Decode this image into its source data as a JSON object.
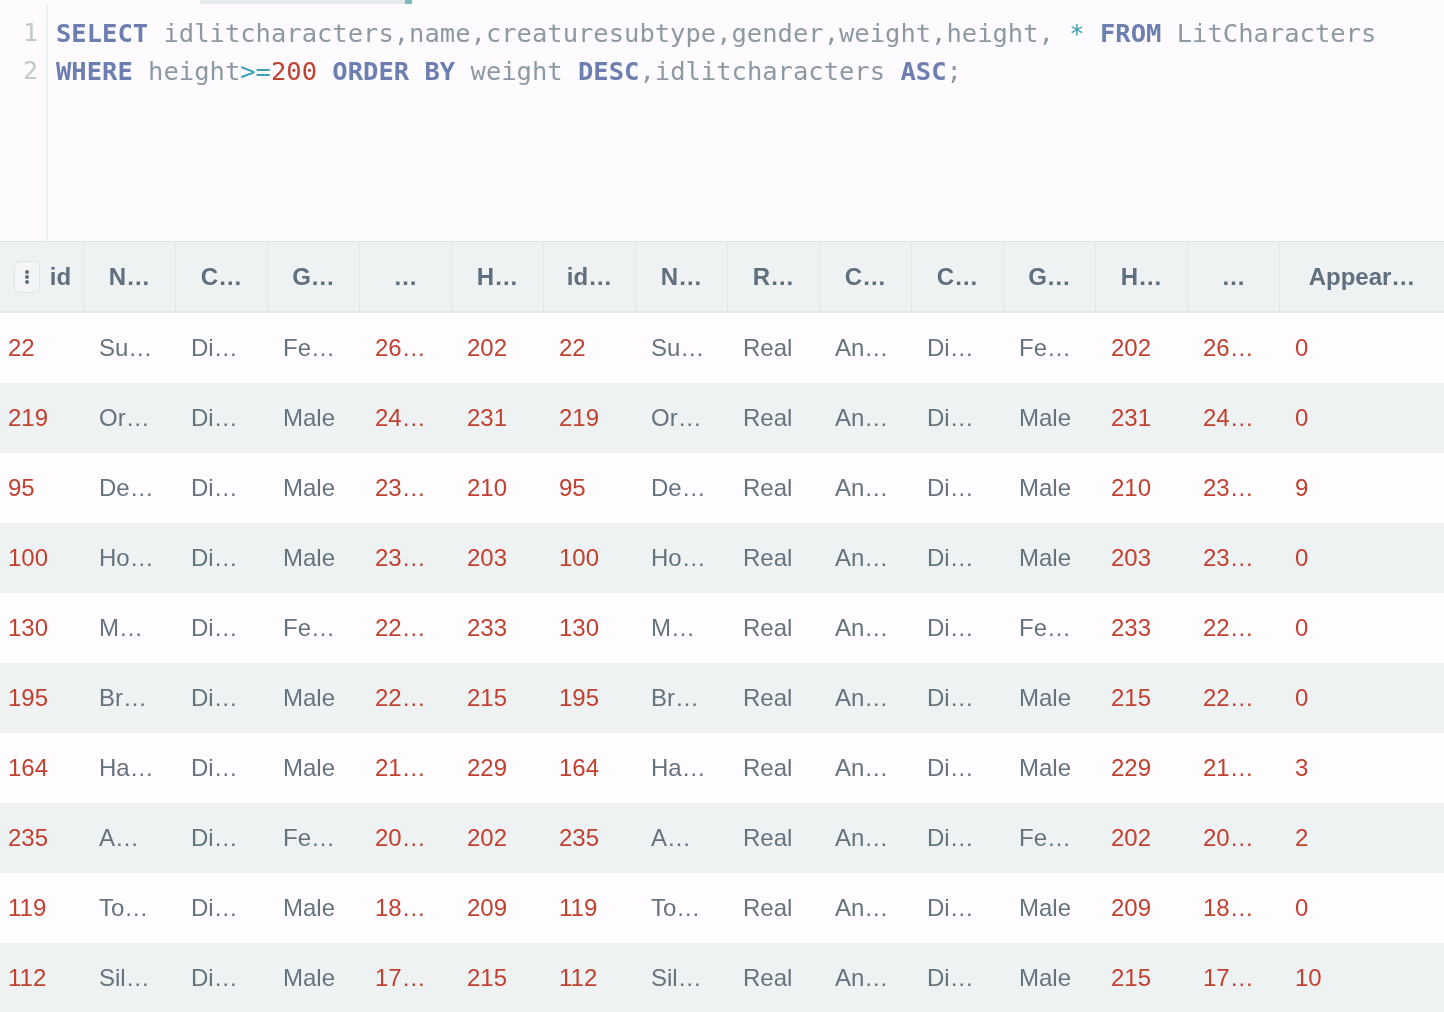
{
  "editor": {
    "lines": [
      {
        "number": "1",
        "tokens": [
          {
            "kind": "keyword",
            "text": "SELECT"
          },
          {
            "kind": "ident",
            "text": " idlitcharacters,name,creaturesubtype,gender,weight,height, "
          },
          {
            "kind": "op",
            "text": "*"
          },
          {
            "kind": "keyword",
            "text": " FROM"
          },
          {
            "kind": "ident",
            "text": " LitCharacters"
          }
        ]
      },
      {
        "number": "2",
        "tokens": [
          {
            "kind": "keyword",
            "text": "WHERE"
          },
          {
            "kind": "ident",
            "text": " height"
          },
          {
            "kind": "op",
            "text": ">="
          },
          {
            "kind": "number",
            "text": "200"
          },
          {
            "kind": "keyword",
            "text": " ORDER BY"
          },
          {
            "kind": "ident",
            "text": " weight "
          },
          {
            "kind": "keyword",
            "text": "DESC"
          },
          {
            "kind": "ident",
            "text": ",idlitcharacters "
          },
          {
            "kind": "keyword",
            "text": "ASC"
          },
          {
            "kind": "ident",
            "text": ";"
          }
        ]
      }
    ]
  },
  "table": {
    "columns": [
      {
        "label": "id",
        "kind": "number"
      },
      {
        "label": "N…",
        "kind": "text"
      },
      {
        "label": "C…",
        "kind": "text"
      },
      {
        "label": "G…",
        "kind": "text"
      },
      {
        "label": "…",
        "kind": "number"
      },
      {
        "label": "H…",
        "kind": "number"
      },
      {
        "label": "id…",
        "kind": "number"
      },
      {
        "label": "N…",
        "kind": "text"
      },
      {
        "label": "R…",
        "kind": "text"
      },
      {
        "label": "C…",
        "kind": "text"
      },
      {
        "label": "C…",
        "kind": "text"
      },
      {
        "label": "G…",
        "kind": "text"
      },
      {
        "label": "H…",
        "kind": "number"
      },
      {
        "label": "…",
        "kind": "number"
      },
      {
        "label": "Appear…",
        "kind": "number"
      }
    ],
    "rows": [
      [
        "22",
        "Su…",
        "Di…",
        "Fe…",
        "26…",
        "202",
        "22",
        "Su…",
        "Real",
        "An…",
        "Di…",
        "Fe…",
        "202",
        "26…",
        "0"
      ],
      [
        "219",
        "Or…",
        "Di…",
        "Male",
        "24…",
        "231",
        "219",
        "Or…",
        "Real",
        "An…",
        "Di…",
        "Male",
        "231",
        "24…",
        "0"
      ],
      [
        "95",
        "De…",
        "Di…",
        "Male",
        "23…",
        "210",
        "95",
        "De…",
        "Real",
        "An…",
        "Di…",
        "Male",
        "210",
        "23…",
        "9"
      ],
      [
        "100",
        "Ho…",
        "Di…",
        "Male",
        "23…",
        "203",
        "100",
        "Ho…",
        "Real",
        "An…",
        "Di…",
        "Male",
        "203",
        "23…",
        "0"
      ],
      [
        "130",
        "M…",
        "Di…",
        "Fe…",
        "22…",
        "233",
        "130",
        "M…",
        "Real",
        "An…",
        "Di…",
        "Fe…",
        "233",
        "22…",
        "0"
      ],
      [
        "195",
        "Br…",
        "Di…",
        "Male",
        "22…",
        "215",
        "195",
        "Br…",
        "Real",
        "An…",
        "Di…",
        "Male",
        "215",
        "22…",
        "0"
      ],
      [
        "164",
        "Ha…",
        "Di…",
        "Male",
        "21…",
        "229",
        "164",
        "Ha…",
        "Real",
        "An…",
        "Di…",
        "Male",
        "229",
        "21…",
        "3"
      ],
      [
        "235",
        "A…",
        "Di…",
        "Fe…",
        "20…",
        "202",
        "235",
        "A…",
        "Real",
        "An…",
        "Di…",
        "Fe…",
        "202",
        "20…",
        "2"
      ],
      [
        "119",
        "To…",
        "Di…",
        "Male",
        "18…",
        "209",
        "119",
        "To…",
        "Real",
        "An…",
        "Di…",
        "Male",
        "209",
        "18…",
        "0"
      ],
      [
        "112",
        "Sil…",
        "Di…",
        "Male",
        "17…",
        "215",
        "112",
        "Sil…",
        "Real",
        "An…",
        "Di…",
        "Male",
        "215",
        "17…",
        "10"
      ]
    ]
  }
}
